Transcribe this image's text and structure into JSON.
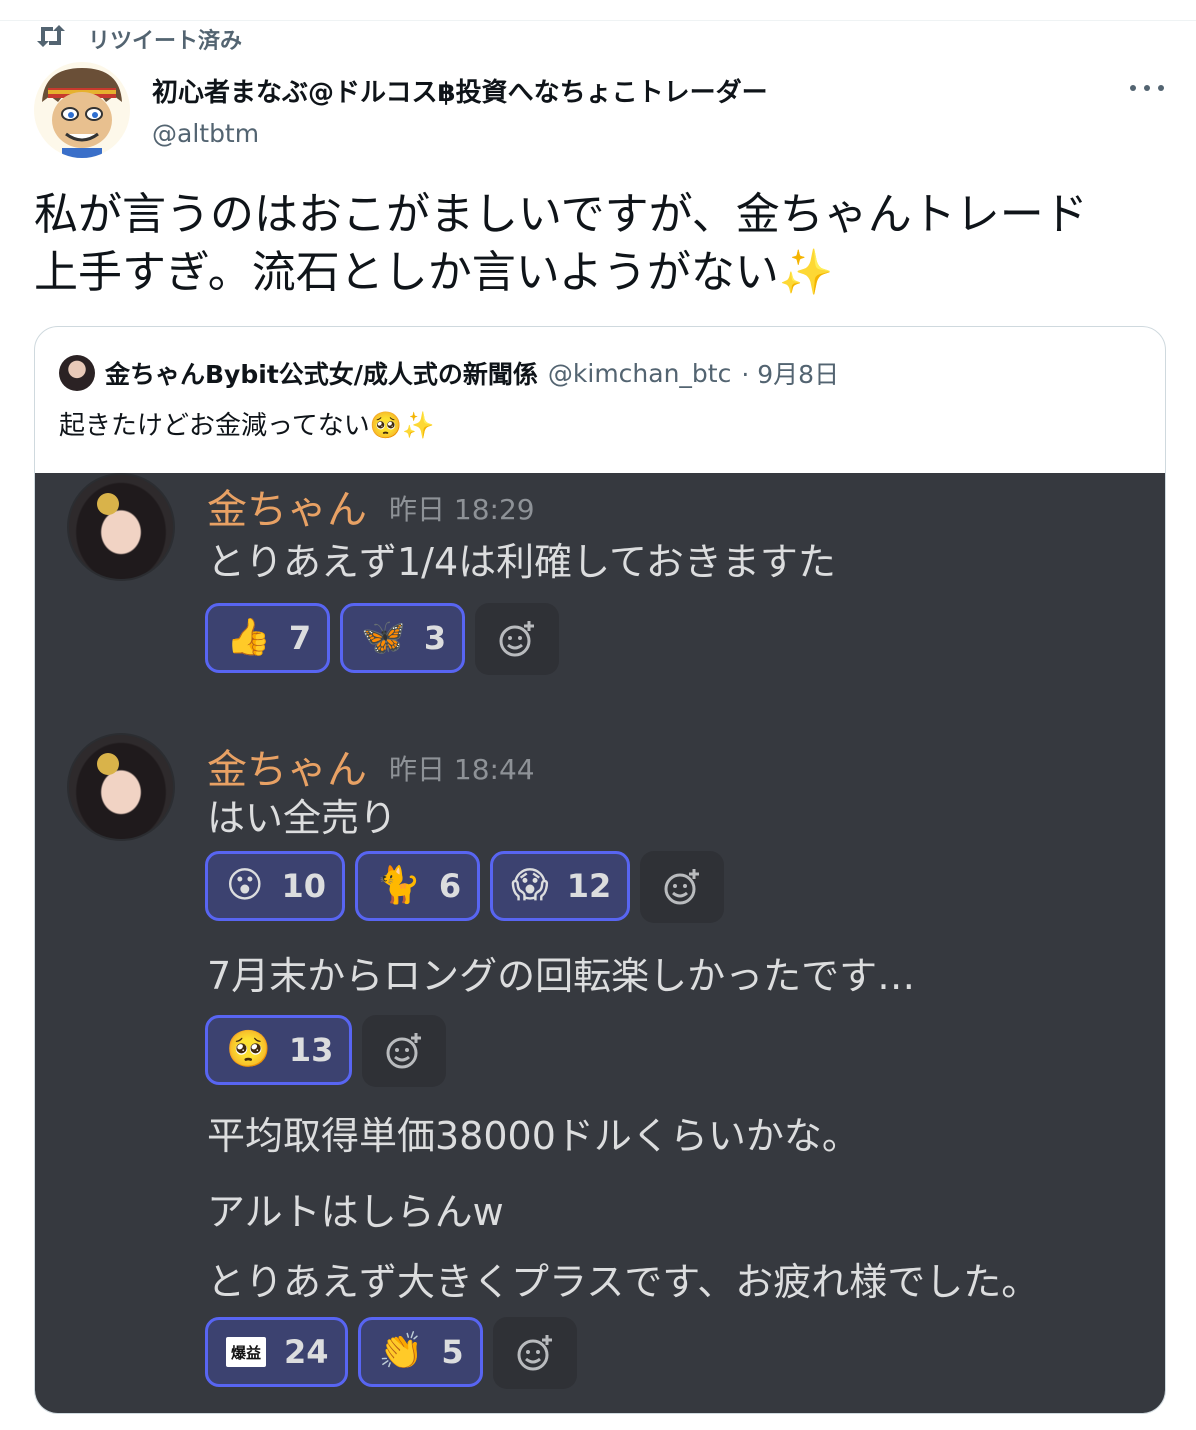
{
  "retweet": {
    "label": "リツイート済み"
  },
  "author": {
    "name": "初心者まなぶ@ドルコス฿投資へなちょこトレーダー",
    "handle": "@altbtm"
  },
  "tweet": {
    "line1": "私が言うのはおこがましいですが、金ちゃんトレード",
    "line2": "上手すぎ。流石としか言いようがない",
    "sparkle": "✨"
  },
  "quote": {
    "name": "金ちゃんBybit公式女/成人式の新聞係",
    "handle": "@kimchan_btc",
    "date": "· 9月8日",
    "text": "起きたけどお金減ってない",
    "text_emoji": "🥺",
    "text_sparkle": "✨"
  },
  "discord": {
    "messages": [
      {
        "author": "金ちゃん",
        "time": "昨日 18:29",
        "lines": [
          "とりあえず1/4は利確しておきますた"
        ],
        "reactions": [
          {
            "emoji": "👍",
            "count": "7"
          },
          {
            "emoji": "🦋",
            "count": "3"
          }
        ]
      },
      {
        "author": "金ちゃん",
        "time": "昨日 18:44",
        "lines": [
          "はい全売り",
          "7月末からロングの回転楽しかったです…",
          "平均取得単価38000ドルくらいかな。",
          "アルトはしらんw",
          "とりあえず大きくプラスです、お疲れ様でした。"
        ],
        "reactions_a": [
          {
            "emoji": "😮",
            "count": "10"
          },
          {
            "emoji": "🐈",
            "count": "6"
          },
          {
            "emoji": "😱",
            "count": "12"
          }
        ],
        "reactions_b": [
          {
            "emoji": "🥺",
            "count": "13"
          }
        ],
        "reactions_c": [
          {
            "emoji": "爆益",
            "count": "24"
          },
          {
            "emoji": "👏",
            "count": "5"
          }
        ]
      }
    ]
  },
  "colors": {
    "accent": "#5865f2",
    "discord_bg": "#36393f",
    "username": "#e8a164",
    "sparkle": "#f5b21b"
  }
}
